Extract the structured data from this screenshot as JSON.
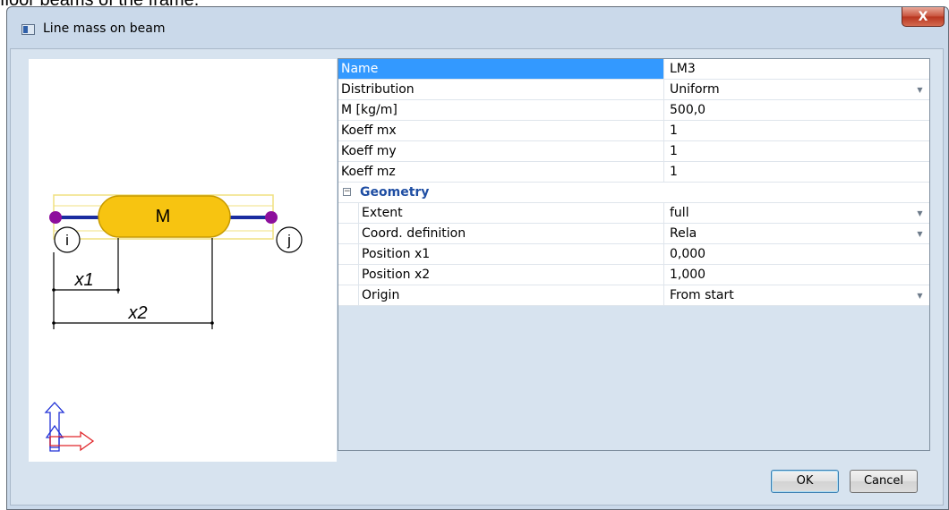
{
  "background_text": "floor beams of the frame.",
  "window": {
    "title": "Line mass on beam",
    "close_label": "X"
  },
  "diagram": {
    "mass_label": "M",
    "node_i": "i",
    "node_j": "j",
    "dim_x1": "x1",
    "dim_x2": "x2",
    "colors": {
      "mass_fill": "#f7c411",
      "beam": "#1a2ca0",
      "nodes": "#8d0f9c",
      "axis_x": "#e0262a",
      "axis_z": "#2031d6"
    }
  },
  "properties": {
    "rows": [
      {
        "label": "Name",
        "value": "LM3",
        "dropdown": false,
        "selected": true
      },
      {
        "label": "Distribution",
        "value": "Uniform",
        "dropdown": true
      },
      {
        "label": "M [kg/m]",
        "value": "500,0",
        "dropdown": false
      },
      {
        "label": "Koeff mx",
        "value": "1",
        "dropdown": false
      },
      {
        "label": "Koeff my",
        "value": "1",
        "dropdown": false
      },
      {
        "label": "Koeff mz",
        "value": "1",
        "dropdown": false
      }
    ],
    "group": {
      "label": "Geometry",
      "expander": "−"
    },
    "geometry_rows": [
      {
        "label": "Extent",
        "value": "full",
        "dropdown": true
      },
      {
        "label": "Coord. definition",
        "value": "Rela",
        "dropdown": true
      },
      {
        "label": "Position x1",
        "value": "0,000",
        "dropdown": false
      },
      {
        "label": "Position x2",
        "value": "1,000",
        "dropdown": false
      },
      {
        "label": "Origin",
        "value": "From start",
        "dropdown": true
      }
    ]
  },
  "buttons": {
    "ok": "OK",
    "cancel": "Cancel"
  }
}
